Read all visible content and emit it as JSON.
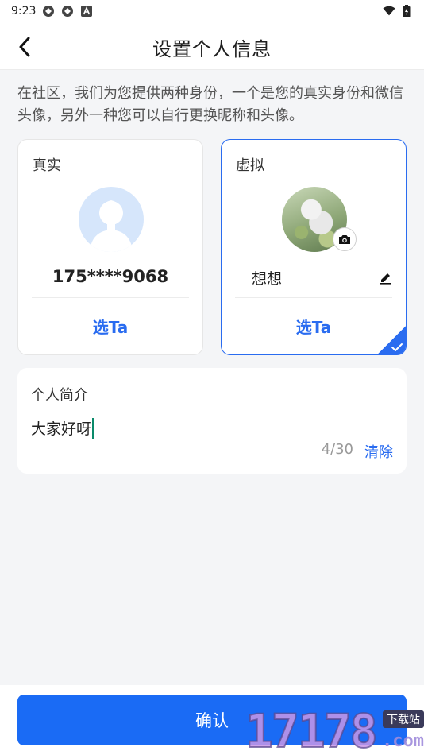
{
  "status_bar": {
    "time": "9:23"
  },
  "header": {
    "title": "设置个人信息"
  },
  "intro": "在社区，我们为您提供两种身份，一个是您的真实身份和微信头像，另外一种您可以自行更换昵称和头像。",
  "cards": {
    "real": {
      "label": "真实",
      "phone": "175****9068",
      "choose_label": "选Ta"
    },
    "virtual": {
      "label": "虚拟",
      "nickname": "想想",
      "choose_label": "选Ta",
      "selected": true
    }
  },
  "bio": {
    "label": "个人简介",
    "value": "大家好呀",
    "count": "4/30",
    "clear_label": "清除"
  },
  "footer": {
    "confirm_label": "确认"
  },
  "watermark": {
    "number": "17178",
    "tag": "下载站",
    "domain": ".com"
  },
  "colors": {
    "accent": "#1a6bf5",
    "page_bg": "#f4f5f7"
  }
}
